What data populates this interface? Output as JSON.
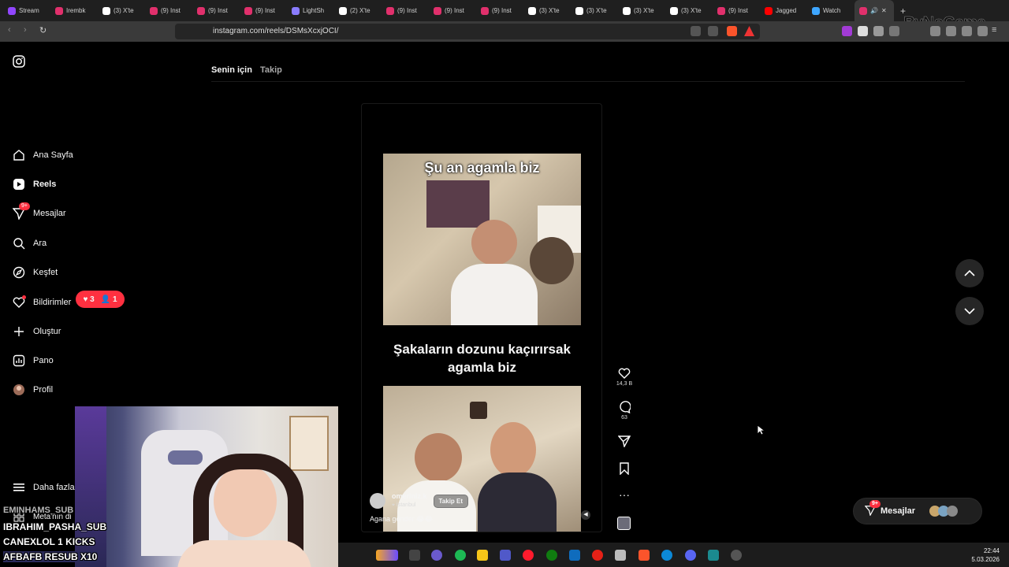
{
  "browser": {
    "tabs": [
      {
        "label": "Stream",
        "color": "#9146ff"
      },
      {
        "label": "Irembk",
        "color": "#e1306c"
      },
      {
        "label": "(3) X'te",
        "color": "#ffffff"
      },
      {
        "label": "(9) Inst",
        "color": "#e1306c"
      },
      {
        "label": "(9) Inst",
        "color": "#e1306c"
      },
      {
        "label": "(9) Inst",
        "color": "#e1306c"
      },
      {
        "label": "LightSh",
        "color": "#8a7cff"
      },
      {
        "label": "(2) X'te",
        "color": "#ffffff"
      },
      {
        "label": "(9) Inst",
        "color": "#e1306c"
      },
      {
        "label": "(9) Inst",
        "color": "#e1306c"
      },
      {
        "label": "(9) Inst",
        "color": "#e1306c"
      },
      {
        "label": "(3) X'te",
        "color": "#ffffff"
      },
      {
        "label": "(3) X'te",
        "color": "#ffffff"
      },
      {
        "label": "(3) X'te",
        "color": "#ffffff"
      },
      {
        "label": "(3) X'te",
        "color": "#ffffff"
      },
      {
        "label": "(9) Inst",
        "color": "#e1306c"
      },
      {
        "label": "Jagged",
        "color": "#ff0000"
      },
      {
        "label": "Watch",
        "color": "#3ea6ff"
      }
    ],
    "url": "instagram.com/reels/DSMsXcxjOCI/",
    "brand_watermark": "ByNoGame"
  },
  "sidebar": {
    "items": [
      {
        "label": "Ana Sayfa",
        "icon": "home-icon"
      },
      {
        "label": "Reels",
        "icon": "reels-icon"
      },
      {
        "label": "Mesajlar",
        "icon": "messenger-icon",
        "badge": "9+"
      },
      {
        "label": "Ara",
        "icon": "search-icon"
      },
      {
        "label": "Keşfet",
        "icon": "compass-icon"
      },
      {
        "label": "Bildirimler",
        "icon": "heart-icon"
      },
      {
        "label": "Oluştur",
        "icon": "plus-icon"
      },
      {
        "label": "Pano",
        "icon": "chart-icon"
      },
      {
        "label": "Profil",
        "icon": "avatar-icon"
      }
    ],
    "more_label": "Daha fazla",
    "meta_label": "Meta'nın di",
    "notif_popup": {
      "likes": "3",
      "follows": "1"
    }
  },
  "feed": {
    "tab_for_you": "Senin için",
    "tab_following": "Takip"
  },
  "reel": {
    "top_text": "Şu an agamla biz",
    "middle_text": "Şakaların dozunu kaçırırsak agamla biz",
    "username": "omeriniz.k",
    "location": "İstanbul",
    "follow_label": "Takip Et",
    "caption": "Agana gönder 😂😂",
    "likes": "14,3 B",
    "comments": "63"
  },
  "messages_pill": {
    "label": "Mesajlar",
    "badge": "9+"
  },
  "overlay_chat": [
    {
      "text": "EMINHAMS_SUB"
    },
    {
      "text": "IBRAHIM_PASHA_SUB"
    },
    {
      "text": "CANEXLOL  1 KICKS"
    },
    {
      "text": "AFBAFB  RESUB X10"
    }
  ],
  "taskbar": {
    "time": "22:44",
    "date": "5.03.2026"
  }
}
